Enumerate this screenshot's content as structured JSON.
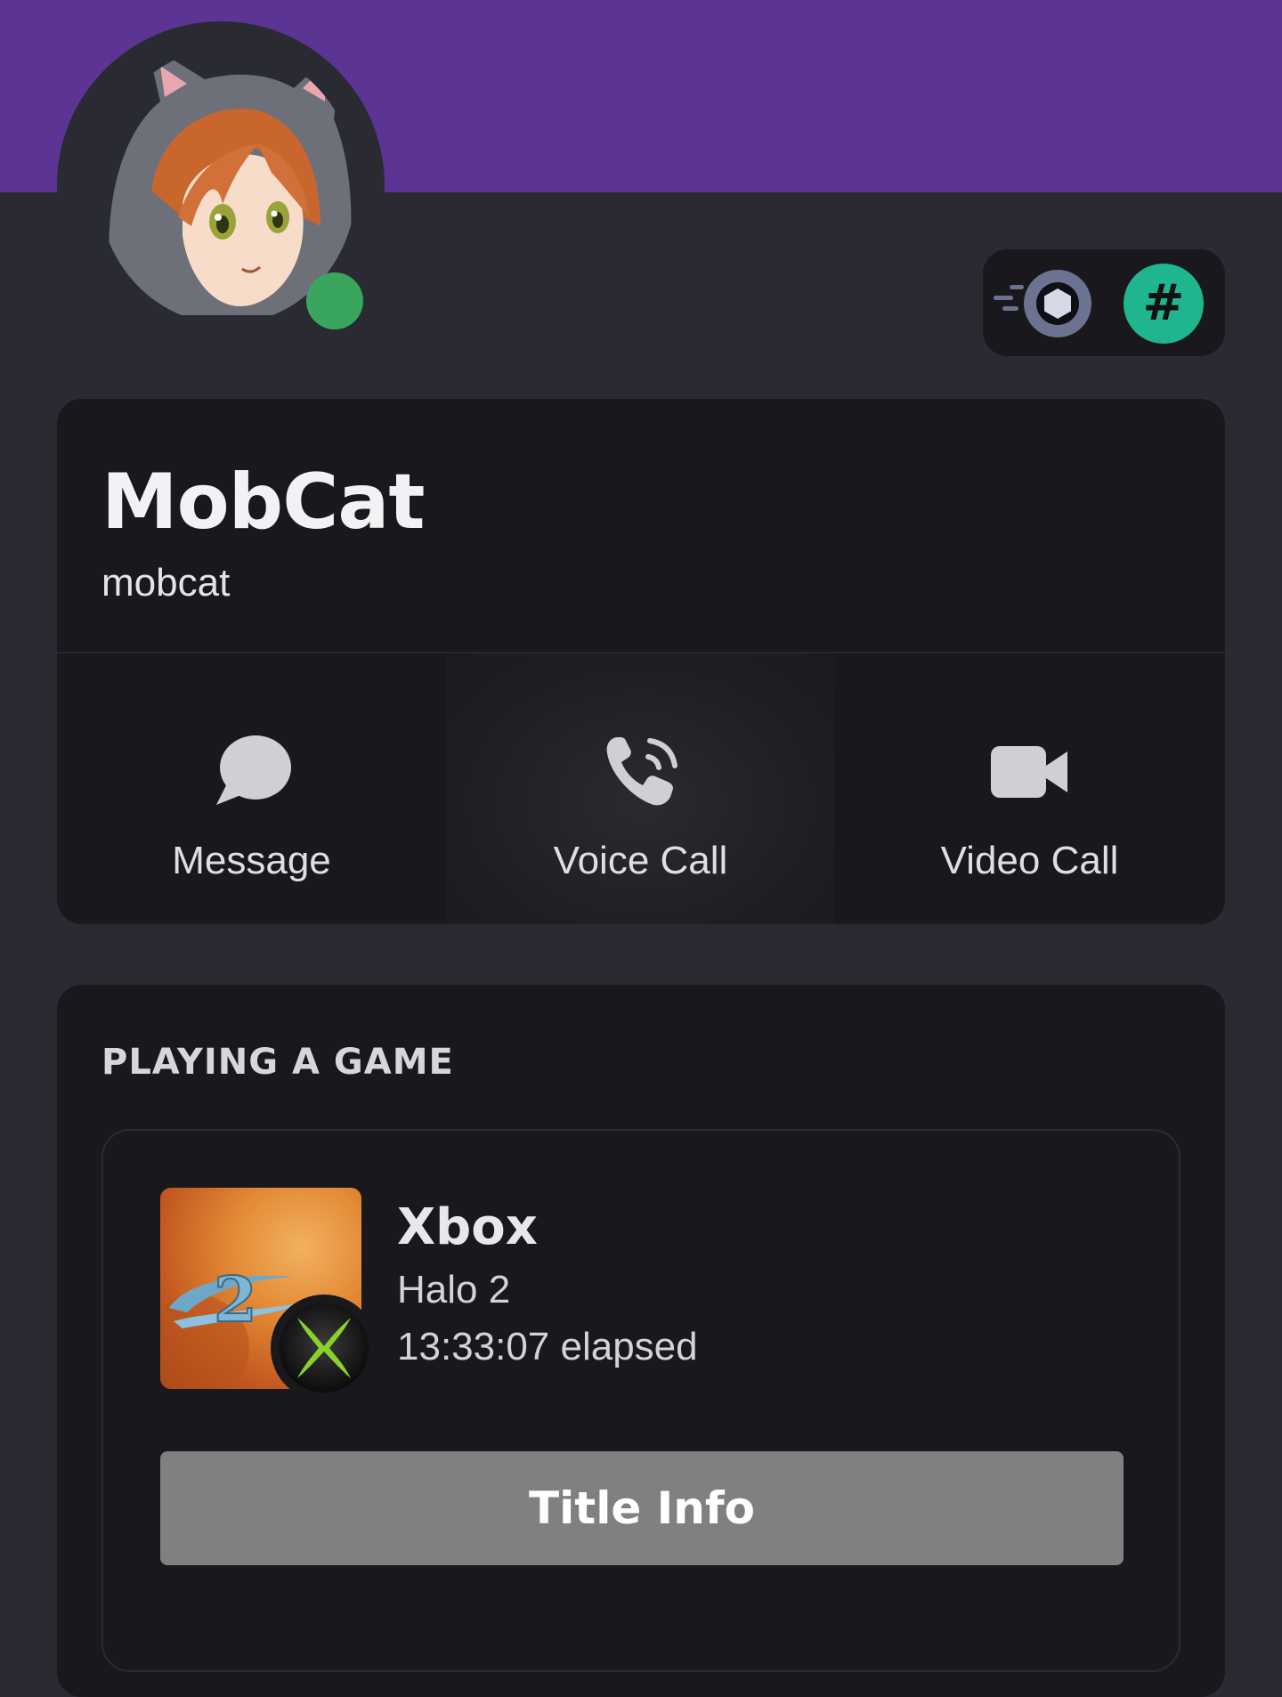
{
  "profile": {
    "display_name": "MobCat",
    "username": "mobcat",
    "status": "online",
    "status_color": "#3aa55d",
    "banner_color": "#5b3494"
  },
  "badges": [
    {
      "icon": "speed-nitro-icon"
    },
    {
      "icon": "hash-icon",
      "glyph": "#",
      "color": "#1eb58f"
    }
  ],
  "actions": {
    "message_label": "Message",
    "voice_call_label": "Voice Call",
    "video_call_label": "Video Call"
  },
  "activity": {
    "section_title": "PLAYING A GAME",
    "name": "Xbox",
    "details": "Halo 2",
    "state": "13:33:07 elapsed",
    "button_label": "Title Info",
    "platform_icon": "xbox-icon",
    "accent_color": "#8ad12c"
  },
  "colors": {
    "background": "#2a2a33",
    "card": "#18181d",
    "button": "#808080"
  }
}
